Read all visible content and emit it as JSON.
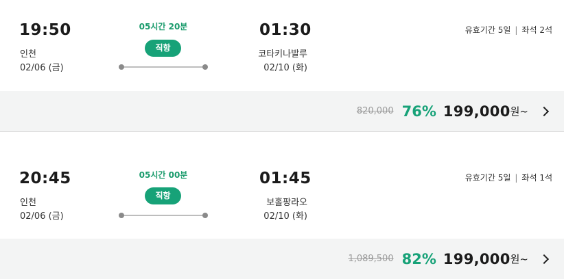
{
  "flights": [
    {
      "departure_time": "19:50",
      "departure_city": "인천",
      "departure_date": "02/06 (금)",
      "duration": "05시간 20분",
      "badge": "직항",
      "arrival_time": "01:30",
      "arrival_city": "코타키나발루",
      "arrival_date": "02/10 (화)",
      "validity": "유효기간 5일",
      "seats": "좌석 2석",
      "separator": "|",
      "original_price": "820,000",
      "discount": "76%",
      "price": "199,000",
      "price_suffix": "원~"
    },
    {
      "departure_time": "20:45",
      "departure_city": "인천",
      "departure_date": "02/06 (금)",
      "duration": "05시간 00분",
      "badge": "직항",
      "arrival_time": "01:45",
      "arrival_city": "보홀팡라오",
      "arrival_date": "02/10 (화)",
      "validity": "유효기간 5일",
      "seats": "좌석 1석",
      "separator": "|",
      "original_price": "1,089,500",
      "discount": "82%",
      "price": "199,000",
      "price_suffix": "원~"
    }
  ],
  "colors": {
    "accent": "#17a278",
    "price_bar_bg": "#f3f4f4"
  },
  "icons": {
    "more": "chevron-right-icon"
  }
}
